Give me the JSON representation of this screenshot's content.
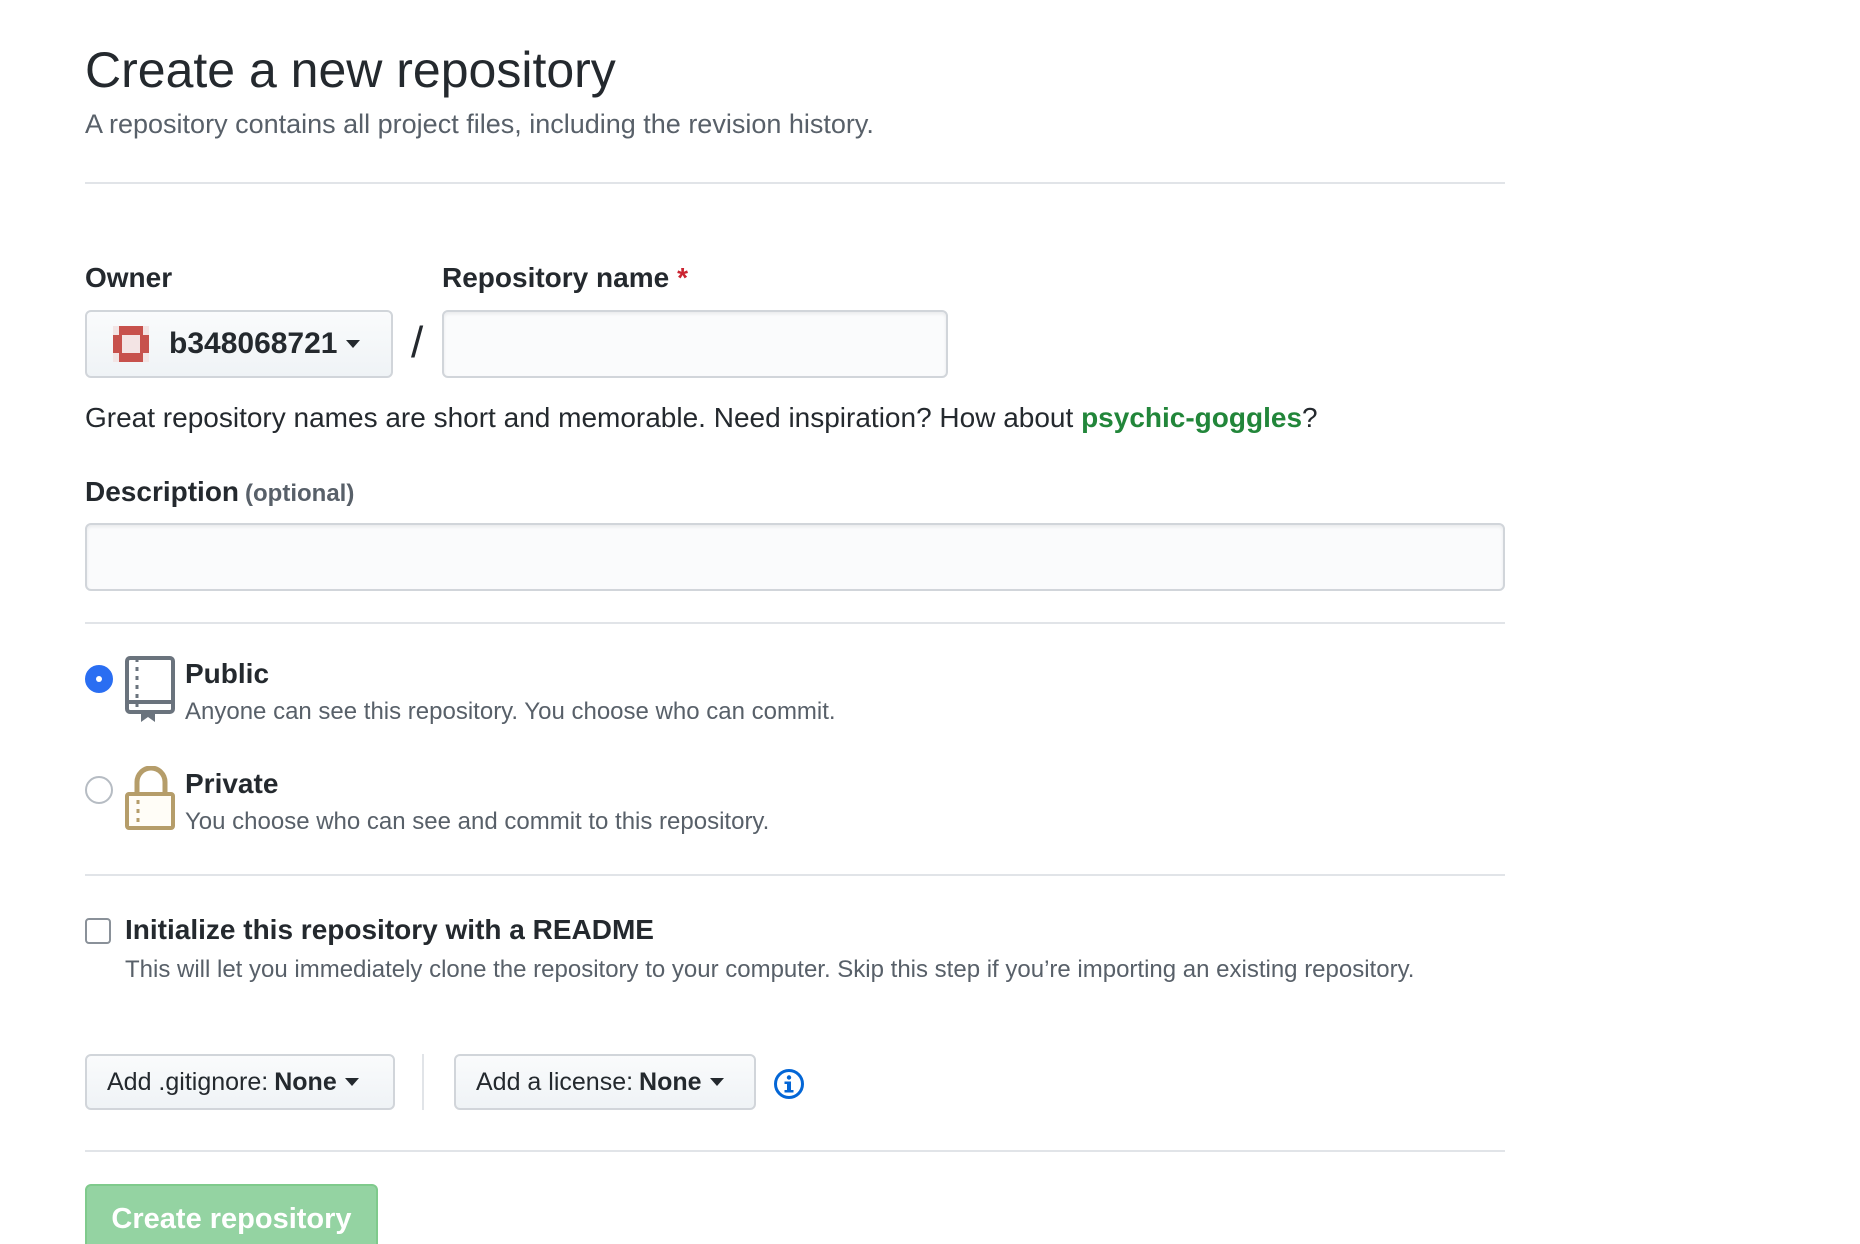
{
  "header": {
    "title": "Create a new repository",
    "subtitle": "A repository contains all project files, including the revision history."
  },
  "owner": {
    "label": "Owner",
    "selected": "b348068721",
    "avatar_color": "#c7514c"
  },
  "repo_name": {
    "label": "Repository name",
    "required_mark": "*",
    "value": "",
    "placeholder": ""
  },
  "separator": "/",
  "hint": {
    "text": "Great repository names are short and memorable. Need inspiration? How about ",
    "suggestion": "psychic-goggles",
    "suffix": "?"
  },
  "description": {
    "label": "Description",
    "optional": "(optional)",
    "value": "",
    "placeholder": ""
  },
  "visibility": {
    "selected": "public",
    "options": [
      {
        "id": "public",
        "title": "Public",
        "description": "Anyone can see this repository. You choose who can commit.",
        "icon": "repo-icon"
      },
      {
        "id": "private",
        "title": "Private",
        "description": "You choose who can see and commit to this repository.",
        "icon": "lock-icon"
      }
    ]
  },
  "readme": {
    "checked": false,
    "title": "Initialize this repository with a README",
    "description": "This will let you immediately clone the repository to your computer. Skip this step if you’re importing an existing repository."
  },
  "gitignore": {
    "label": "Add .gitignore:",
    "value": "None"
  },
  "license": {
    "label": "Add a license:",
    "value": "None"
  },
  "info_icon": "info-icon",
  "submit": {
    "label": "Create repository",
    "enabled": false
  },
  "colors": {
    "accent_blue": "#2a6ef2",
    "link_green": "#22863a",
    "create_button": "#94d3a2",
    "required_red": "#cb2431",
    "info_blue": "#0366d6"
  }
}
